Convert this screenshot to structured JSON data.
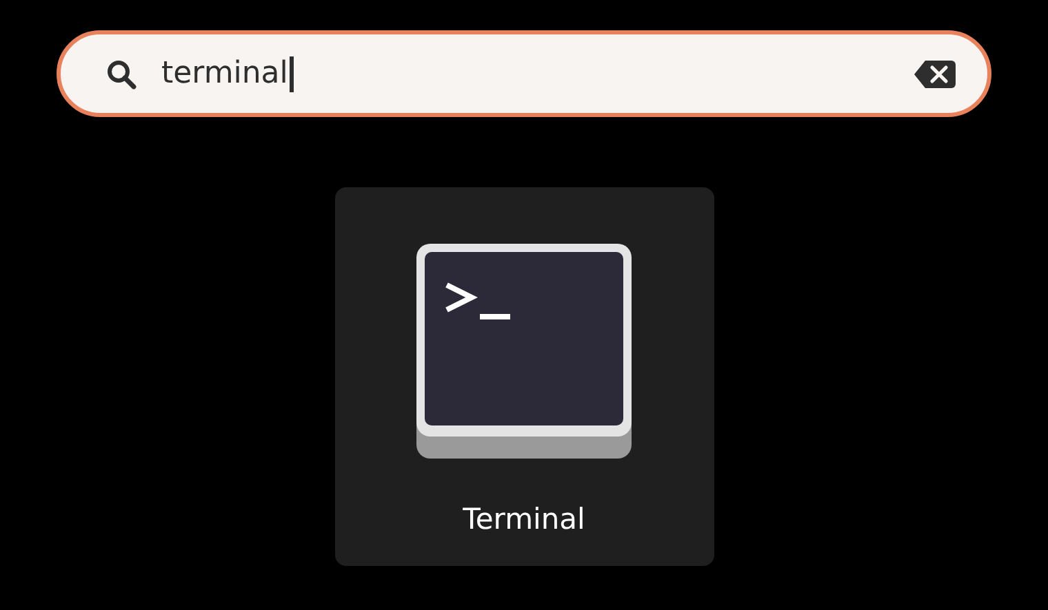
{
  "search": {
    "value": "terminal"
  },
  "results": [
    {
      "label": "Terminal",
      "selected": true
    }
  ]
}
